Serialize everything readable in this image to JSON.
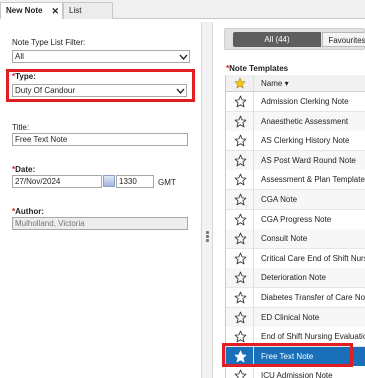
{
  "tabs": [
    {
      "label": "New Note",
      "active": true
    },
    {
      "label": "List",
      "active": false
    }
  ],
  "form": {
    "filter_label": "Note Type List Filter:",
    "filter_value": "All",
    "type_label": "Type:",
    "type_value": "Duty Of Candour",
    "title_label": "Title:",
    "title_value": "Free Text Note",
    "date_label": "Date:",
    "date_value": "27/Nov/2024",
    "time_value": "1330",
    "timezone": "GMT",
    "author_label": "Author:",
    "author_value": "Mulholland, Victoria",
    "required_mark": "*"
  },
  "filter_tabs": {
    "all": "All (44)",
    "favourites": "Favourites"
  },
  "templates": {
    "heading": "Note Templates",
    "column_name": "Name",
    "rows": [
      {
        "name": "Admission Clerking Note",
        "favourite": false,
        "selected": false
      },
      {
        "name": "Anaesthetic Assessment",
        "favourite": false,
        "selected": false
      },
      {
        "name": "AS Clerking History Note",
        "favourite": false,
        "selected": false
      },
      {
        "name": "AS Post Ward Round Note",
        "favourite": false,
        "selected": false
      },
      {
        "name": "Assessment & Plan Template",
        "favourite": false,
        "selected": false
      },
      {
        "name": "CGA Note",
        "favourite": false,
        "selected": false
      },
      {
        "name": "CGA Progress Note",
        "favourite": false,
        "selected": false
      },
      {
        "name": "Consult Note",
        "favourite": false,
        "selected": false
      },
      {
        "name": "Critical Care End of Shift Nursi",
        "favourite": false,
        "selected": false
      },
      {
        "name": "Deterioration Note",
        "favourite": false,
        "selected": false
      },
      {
        "name": "Diabetes Transfer of Care Note",
        "favourite": false,
        "selected": false
      },
      {
        "name": "ED Clinical Note",
        "favourite": false,
        "selected": false
      },
      {
        "name": "End of Shift Nursing Evaluation",
        "favourite": false,
        "selected": false
      },
      {
        "name": "Free Text Note",
        "favourite": true,
        "selected": true
      },
      {
        "name": "ICU Admission Note",
        "favourite": false,
        "selected": false
      }
    ]
  },
  "colors": {
    "highlight": "#e01e24",
    "selected_row": "#1a6fb9",
    "required": "#d02020"
  }
}
